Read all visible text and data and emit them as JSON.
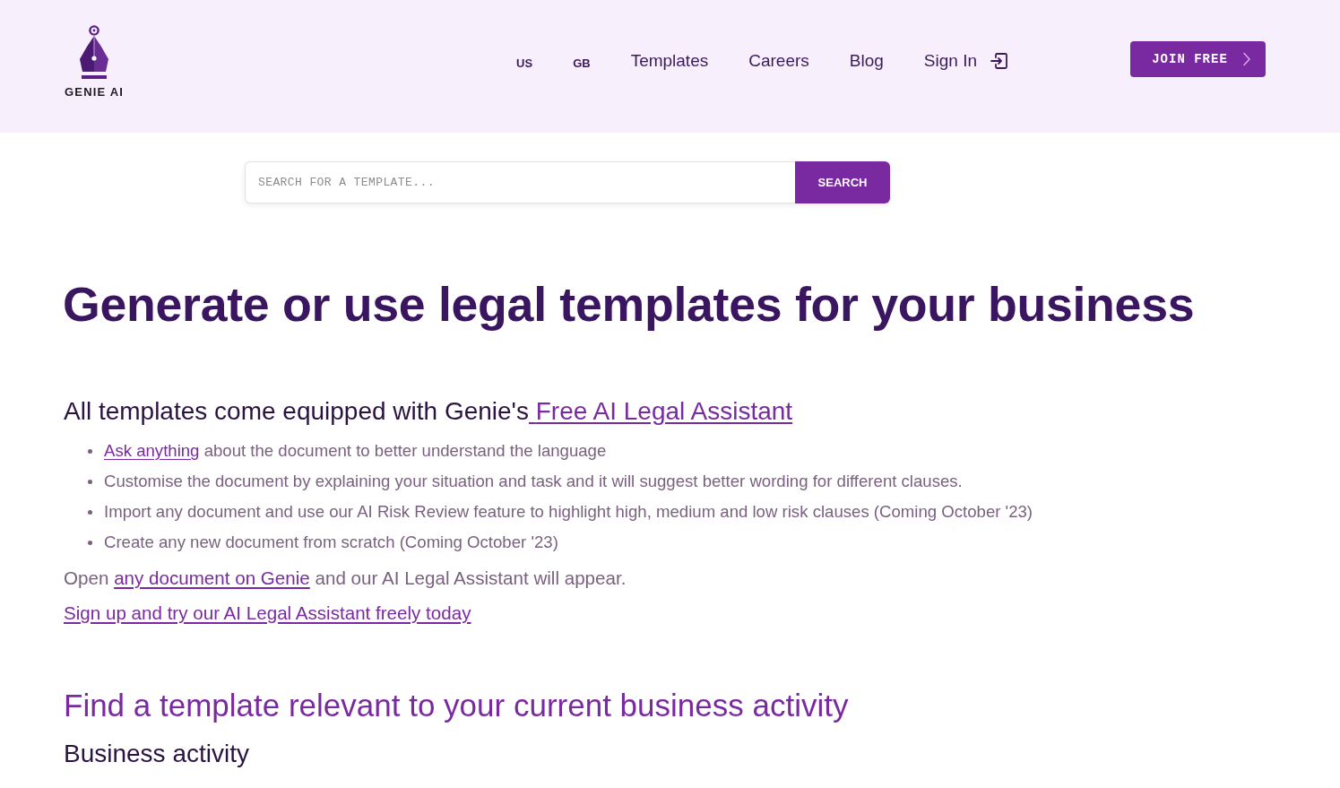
{
  "header": {
    "logo": {
      "text": "GENIE AI"
    },
    "nav": [
      {
        "label": "US",
        "kind": "region"
      },
      {
        "label": "GB",
        "kind": "region"
      },
      {
        "label": "Templates",
        "kind": "link"
      },
      {
        "label": "Careers",
        "kind": "link"
      },
      {
        "label": "Blog",
        "kind": "link"
      },
      {
        "label": "Sign In",
        "kind": "signin"
      }
    ],
    "join_button": {
      "label": "JOIN FREE"
    }
  },
  "search": {
    "placeholder": "SEARCH FOR A TEMPLATE...",
    "button": "SEARCH"
  },
  "hero": {
    "title": "Generate or use legal templates for your business"
  },
  "assistant": {
    "heading": [
      {
        "kind": "text",
        "text": "All templates come equipped with Genie's"
      },
      {
        "kind": "link",
        "text": "Free AI Legal Assistant"
      }
    ],
    "bullets": [
      {
        "parts": [
          {
            "kind": "link",
            "text": "Ask anything"
          },
          {
            "kind": "text",
            "text": "about the document to better understand the language"
          }
        ]
      },
      {
        "parts": [
          {
            "kind": "text",
            "text": "Customise the document by explaining your situation and task and it will suggest better wording for different clauses."
          }
        ]
      },
      {
        "parts": [
          {
            "kind": "text",
            "text": "Import any document and use our AI Risk Review feature to highlight high, medium and low risk clauses (Coming October '23)"
          }
        ]
      },
      {
        "parts": [
          {
            "kind": "text",
            "text": "Create any new document from scratch (Coming October '23)"
          }
        ]
      }
    ],
    "paragraph": [
      {
        "kind": "text",
        "text": "Open"
      },
      {
        "kind": "link",
        "text": "any document on Genie"
      },
      {
        "kind": "text",
        "text": "and our AI Legal Assistant will appear."
      }
    ],
    "signup_link": "Sign up and try our AI Legal Assistant freely today"
  },
  "find": {
    "heading": "Find a template relevant to your current business activity",
    "subheading": "Business activity"
  }
}
